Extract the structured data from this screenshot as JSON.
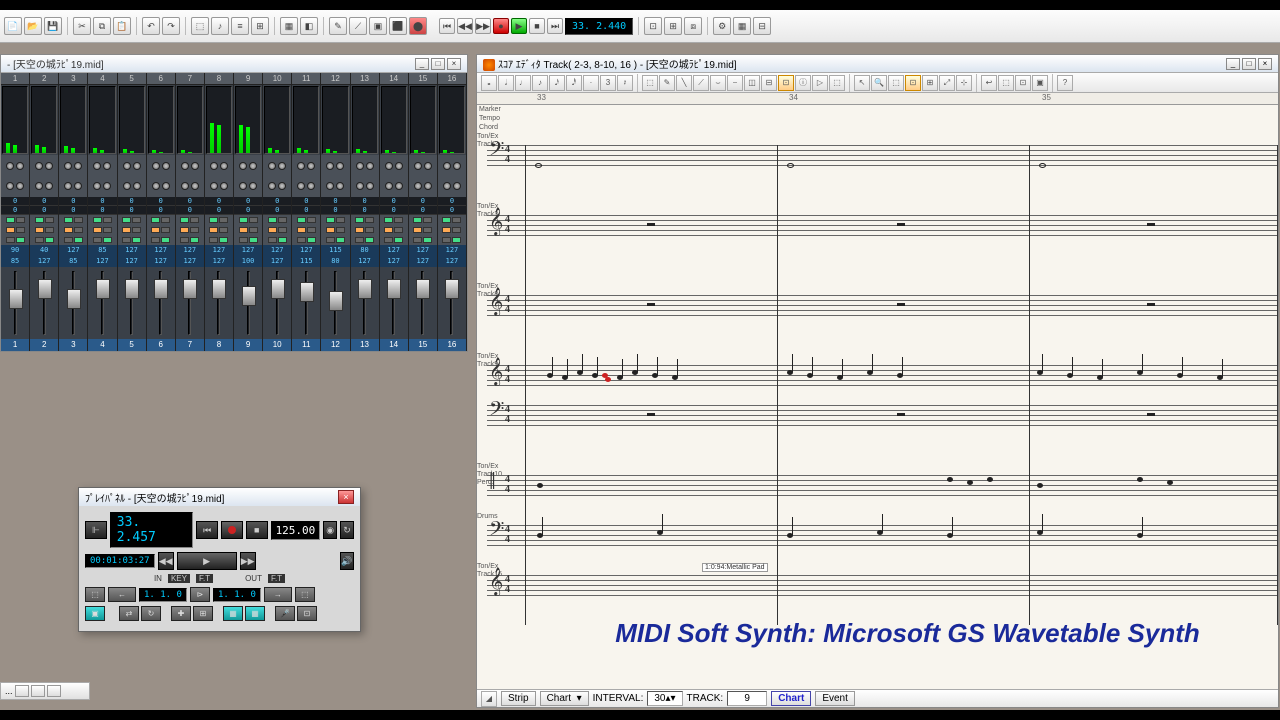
{
  "toolbar": {
    "counter": "33. 2.440"
  },
  "mixer": {
    "title": "- [天空の城ﾗﾋﾟ19.mid]",
    "channels": [
      {
        "n": 1,
        "val1": 0,
        "val2": 0,
        "vol": 85,
        "pan": 90,
        "meter": 15,
        "fader": 28
      },
      {
        "n": 2,
        "val1": 0,
        "val2": 0,
        "vol": 127,
        "pan": 40,
        "meter": 12,
        "fader": 12
      },
      {
        "n": 3,
        "val1": 0,
        "val2": 0,
        "vol": 85,
        "pan": 127,
        "meter": 10,
        "fader": 28
      },
      {
        "n": 4,
        "val1": 0,
        "val2": 0,
        "vol": 127,
        "pan": 85,
        "meter": 8,
        "fader": 12
      },
      {
        "n": 5,
        "val1": 0,
        "val2": 0,
        "vol": 127,
        "pan": 127,
        "meter": 6,
        "fader": 12
      },
      {
        "n": 6,
        "val1": 0,
        "val2": 0,
        "vol": 127,
        "pan": 127,
        "meter": 5,
        "fader": 12
      },
      {
        "n": 7,
        "val1": 0,
        "val2": 0,
        "vol": 127,
        "pan": 127,
        "meter": 4,
        "fader": 12
      },
      {
        "n": 8,
        "val1": 0,
        "val2": 0,
        "vol": 127,
        "pan": 127,
        "meter": 45,
        "fader": 12
      },
      {
        "n": 9,
        "val1": 0,
        "val2": 0,
        "vol": 100,
        "pan": 127,
        "meter": 42,
        "fader": 22
      },
      {
        "n": 10,
        "val1": 0,
        "val2": 0,
        "vol": 127,
        "pan": 127,
        "meter": 8,
        "fader": 12
      },
      {
        "n": 11,
        "val1": 0,
        "val2": 0,
        "vol": 115,
        "pan": 127,
        "meter": 8,
        "fader": 16
      },
      {
        "n": 12,
        "val1": 0,
        "val2": 0,
        "vol": 80,
        "pan": 115,
        "meter": 6,
        "fader": 30
      },
      {
        "n": 13,
        "val1": 0,
        "val2": 0,
        "vol": 127,
        "pan": 80,
        "meter": 6,
        "fader": 12
      },
      {
        "n": 14,
        "val1": 0,
        "val2": 0,
        "vol": 127,
        "pan": 127,
        "meter": 4,
        "fader": 12
      },
      {
        "n": 15,
        "val1": 0,
        "val2": 0,
        "vol": 127,
        "pan": 127,
        "meter": 4,
        "fader": 12
      },
      {
        "n": 16,
        "val1": 0,
        "val2": 0,
        "vol": 127,
        "pan": 127,
        "meter": 4,
        "fader": 12
      }
    ]
  },
  "score": {
    "title": "ｽｺｱ ｴﾃﾞｨﾀ Track( 2-3, 8-10, 16 ) - [天空の城ﾗﾋﾟ19.mid]",
    "ruler_marks": [
      {
        "pos": 60,
        "label": "33"
      },
      {
        "pos": 312,
        "label": "34"
      },
      {
        "pos": 565,
        "label": "35"
      }
    ],
    "info_rows": [
      "Marker",
      "Tempo",
      "Chord"
    ],
    "tracks": [
      {
        "label": "Ton/Ex\nTrack2",
        "clef": "𝄢"
      },
      {
        "label": "Ton/Ex\nTrack3",
        "clef": "𝄞"
      },
      {
        "label": "Ton/Ex\nTrack8",
        "clef": "𝄞"
      },
      {
        "label": "Ton/Ex\nTrack9",
        "clef": "𝄞𝄢"
      },
      {
        "label": "Ton/Ex\nTrack10\nPerc.",
        "clef": "‖"
      },
      {
        "label": "Drums",
        "clef": "𝄢"
      },
      {
        "label": "Ton/Ex\nTrack16",
        "clef": "𝄞"
      }
    ],
    "annotation": "1:0:94:Metallic Pad",
    "overlay": "MIDI Soft Synth: Microsoft GS Wavetable Synth",
    "status": {
      "strip": "Strip",
      "chart": "Chart",
      "interval_label": "INTERVAL:",
      "interval": "30",
      "track_label": "TRACK:",
      "track": "9",
      "chart2": "Chart",
      "event": "Event"
    }
  },
  "playpanel": {
    "title": "ﾌﾟﾚｲﾊﾟﾈﾙ - [天空の城ﾗﾋﾟ19.mid]",
    "counter": "33. 2.457",
    "time": "00:01:03:27",
    "tempo": "125.00",
    "in_label": "IN",
    "out_label": "OUT",
    "in_val": "1. 1. 0",
    "out_val": "1. 1. 0",
    "key": "KEY",
    "ft": "F.T"
  }
}
